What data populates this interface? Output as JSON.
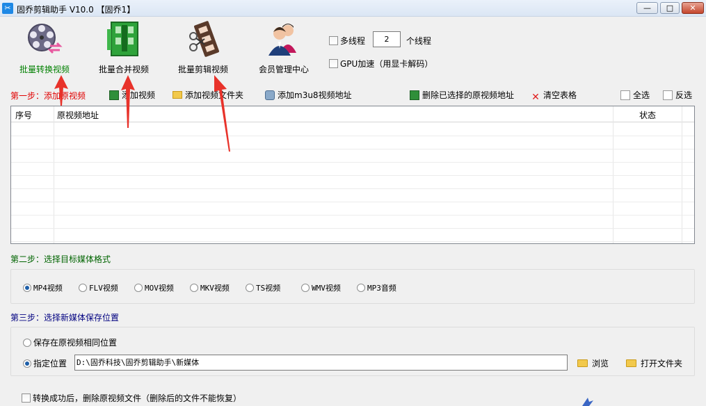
{
  "window": {
    "title": "固乔剪辑助手 V10.0  【固乔1】",
    "min_label": "—",
    "max_label": "□",
    "close_label": "✕"
  },
  "toolbar": {
    "convert_label": "批量转换视频",
    "merge_label": "批量合并视频",
    "clip_label": "批量剪辑视频",
    "member_label": "会员管理中心",
    "multithread_label": "多线程",
    "thread_count": "2",
    "thread_unit": "个线程",
    "gpu_label": "GPU加速（用显卡解码）"
  },
  "step1": {
    "label": "第一步：添加原视频",
    "add_video": "添加视频",
    "add_folder": "添加视频文件夹",
    "add_m3u8": "添加m3u8视频地址",
    "delete_selected": "删除已选择的原视频地址",
    "clear_table": "清空表格",
    "select_all": "全选",
    "invert": "反选"
  },
  "table": {
    "col_index": "序号",
    "col_path": "原视频地址",
    "col_status": "状态"
  },
  "step2": {
    "label": "第二步：选择目标媒体格式",
    "formats": [
      "MP4视频",
      "FLV视频",
      "MOV视频",
      "MKV视频",
      "TS视频",
      "WMV视频",
      "MP3音频"
    ],
    "selected": "MP4视频"
  },
  "step3": {
    "label": "第三步：选择新媒体保存位置",
    "same_location": "保存在原视频相同位置",
    "specify_location": "指定位置",
    "path_value": "D:\\固乔科技\\固乔剪辑助手\\新媒体",
    "browse": "浏览",
    "open_folder": "打开文件夹"
  },
  "bottom": {
    "delete_after": "转换成功后，删除原视频文件（删除后的文件不能恢复）"
  },
  "colors": {
    "step1": "#e00000",
    "step2": "#006400",
    "step3": "#000080",
    "annotation_arrow": "#e8322a"
  }
}
